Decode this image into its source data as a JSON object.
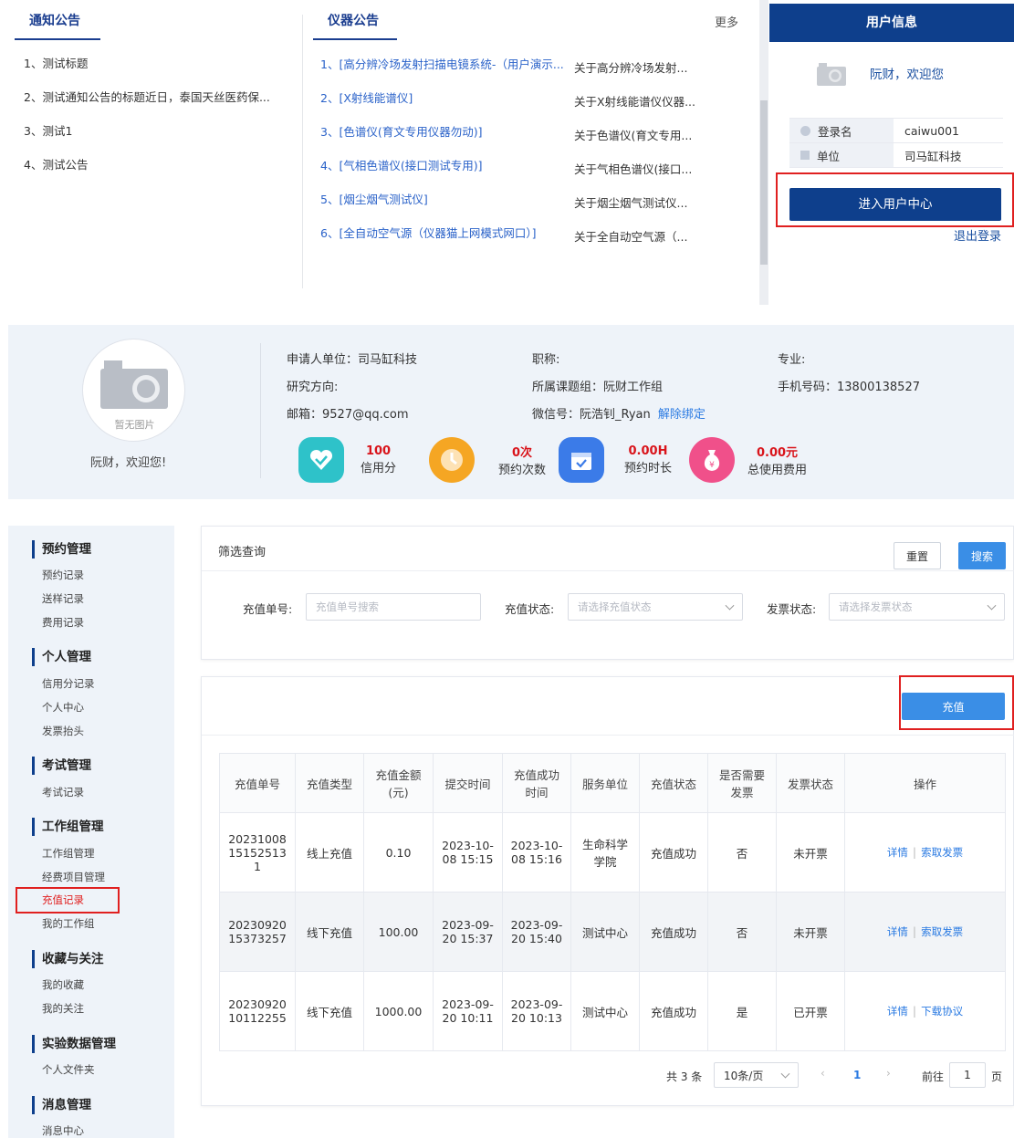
{
  "notices": {
    "tab_label": "通知公告",
    "items": [
      "1、测试标题",
      "2、测试通知公告的标题近日，泰国天丝医药保...",
      "3、测试1",
      "4、测试公告"
    ]
  },
  "instruments": {
    "tab_label": "仪器公告",
    "more_label": "更多",
    "items": [
      {
        "title": "1、[高分辨冷场发射扫描电镜系统-（用户演示...",
        "sub": "关于高分辨冷场发射..."
      },
      {
        "title": "2、[X射线能谱仪]",
        "sub": "关于X射线能谱仪仪器..."
      },
      {
        "title": "3、[色谱仪(育文专用仪器勿动)]",
        "sub": "关于色谱仪(育文专用..."
      },
      {
        "title": "4、[气相色谱仪(接口测试专用)]",
        "sub": "关于气相色谱仪(接口..."
      },
      {
        "title": "5、[烟尘烟气测试仪]",
        "sub": "关于烟尘烟气测试仪..."
      },
      {
        "title": "6、[全自动空气源（仪器猫上网模式网口）]",
        "sub": "关于全自动空气源（..."
      }
    ]
  },
  "userbox": {
    "title": "用户信息",
    "welcome": "阮财，欢迎您",
    "login_label": "登录名",
    "login_value": "caiwu001",
    "unit_label": "单位",
    "unit_value": "司马缸科技",
    "enter_btn": "进入用户中心",
    "logout": "退出登录"
  },
  "profile": {
    "avatar_text": "暂无图片",
    "welcome": "阮财，欢迎您!",
    "unit": "申请人单位：司马缸科技",
    "title_field": "职称:",
    "major": "专业:",
    "research": "研究方向:",
    "group": "所属课题组：阮财工作组",
    "phone": "手机号码：13800138527",
    "email": "邮箱：9527@qq.com",
    "wechat": "微信号：阮浩钊_Ryan",
    "unbind": "解除绑定",
    "stats": [
      {
        "value": "100",
        "label": "信用分",
        "color": "#2ec2c9",
        "icon": "heart-check-icon"
      },
      {
        "value": "0次",
        "label": "预约次数",
        "color": "#f5a623",
        "icon": "clock-icon"
      },
      {
        "value": "0.00H",
        "label": "预约时长",
        "color": "#3b7be8",
        "icon": "calendar-icon"
      },
      {
        "value": "0.00元",
        "label": "总使用费用",
        "color": "#f0508a",
        "icon": "money-bag-icon"
      }
    ]
  },
  "sidebar": {
    "groups": [
      {
        "title": "预约管理",
        "items": [
          "预约记录",
          "送样记录",
          "费用记录"
        ]
      },
      {
        "title": "个人管理",
        "items": [
          "信用分记录",
          "个人中心",
          "发票抬头"
        ]
      },
      {
        "title": "考试管理",
        "items": [
          "考试记录"
        ]
      },
      {
        "title": "工作组管理",
        "items": [
          "工作组管理",
          "经费项目管理",
          "充值记录",
          "我的工作组"
        ]
      },
      {
        "title": "收藏与关注",
        "items": [
          "我的收藏",
          "我的关注"
        ]
      },
      {
        "title": "实验数据管理",
        "items": [
          "个人文件夹"
        ]
      },
      {
        "title": "消息管理",
        "items": [
          "消息中心"
        ]
      }
    ]
  },
  "filter": {
    "title": "筛选查询",
    "reset": "重置",
    "search": "搜索",
    "order_label": "充值单号:",
    "order_placeholder": "充值单号搜索",
    "status_label": "充值状态:",
    "status_placeholder": "请选择充值状态",
    "invoice_label": "发票状态:",
    "invoice_placeholder": "请选择发票状态"
  },
  "recharge_btn": "充值",
  "table": {
    "headers": [
      "充值单号",
      "充值类型",
      "充值金额(元)",
      "提交时间",
      "充值成功时间",
      "服务单位",
      "充值状态",
      "是否需要发票",
      "发票状态",
      "操作"
    ],
    "rows": [
      {
        "no": "20231008151525131",
        "type": "线上充值",
        "amount": "0.10",
        "submit": "2023-10-08 15:15",
        "success": "2023-10-08 15:16",
        "unit": "生命科学学院",
        "status": "充值成功",
        "need": "否",
        "inv": "未开票",
        "op1": "详情",
        "op2": "索取发票"
      },
      {
        "no": "2023092015373257",
        "type": "线下充值",
        "amount": "100.00",
        "submit": "2023-09-20 15:37",
        "success": "2023-09-20 15:40",
        "unit": "测试中心",
        "status": "充值成功",
        "need": "否",
        "inv": "未开票",
        "op1": "详情",
        "op2": "索取发票"
      },
      {
        "no": "2023092010112255",
        "type": "线下充值",
        "amount": "1000.00",
        "submit": "2023-09-20 10:11",
        "success": "2023-09-20 10:13",
        "unit": "测试中心",
        "status": "充值成功",
        "need": "是",
        "inv": "已开票",
        "op1": "详情",
        "op2": "下载协议"
      }
    ]
  },
  "pager": {
    "total": "共 3 条",
    "size": "10条/页",
    "current": "1",
    "goto": "前往",
    "goto_value": "1",
    "page_unit": "页"
  }
}
